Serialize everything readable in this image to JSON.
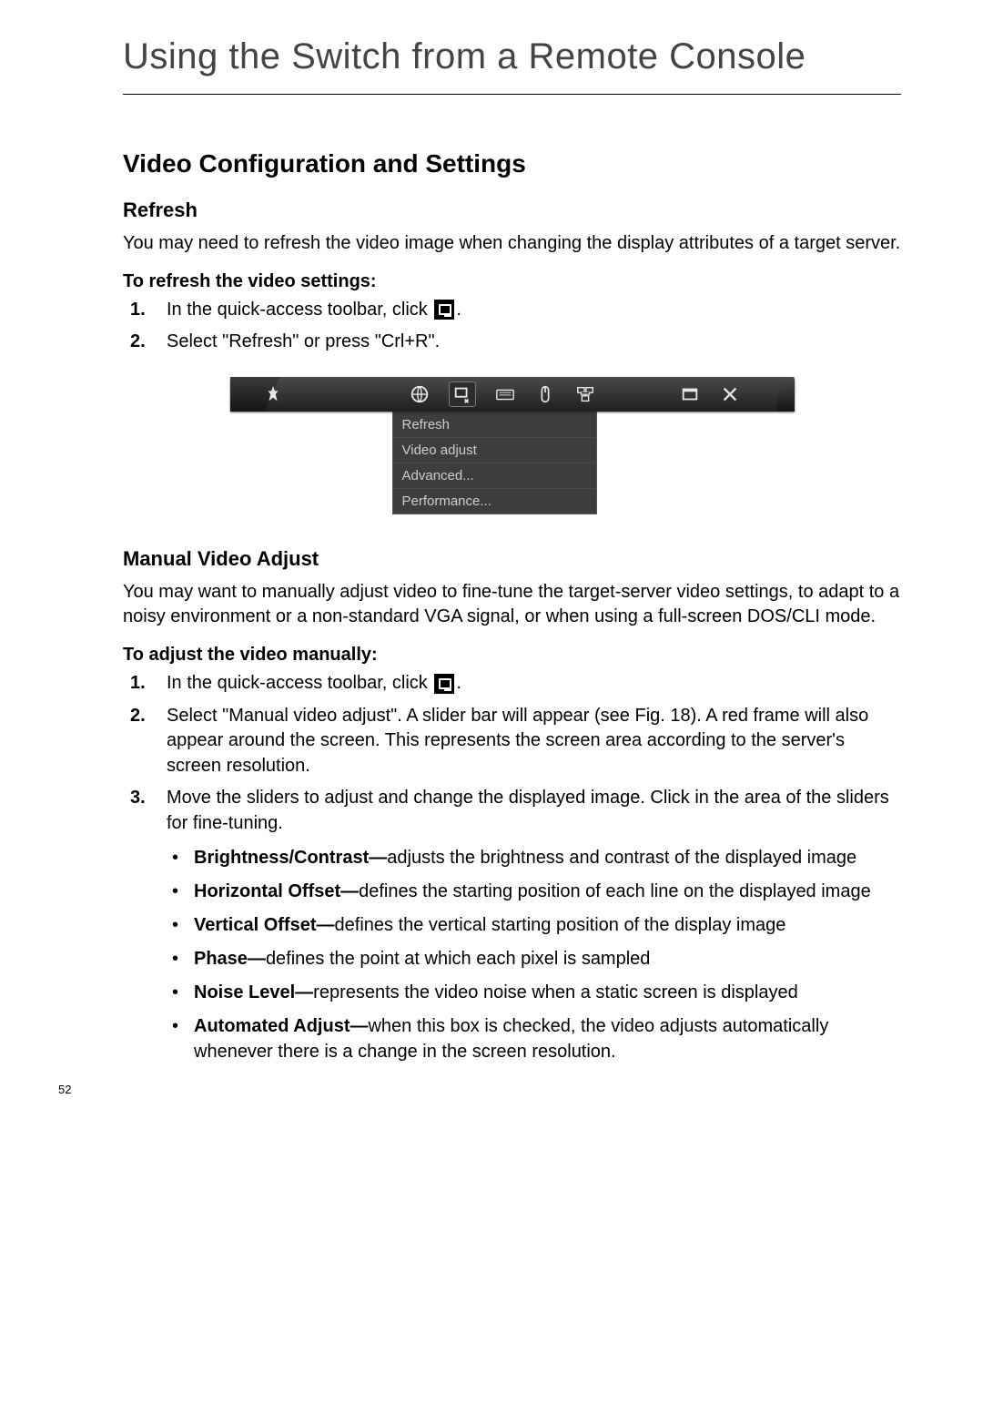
{
  "chapter_title": "Using the Switch from a Remote Console",
  "section_title": "Video Configuration and Settings",
  "refresh": {
    "heading": "Refresh",
    "para": "You may need to refresh the video image when changing the display attributes of a target server.",
    "proc_head": "To refresh the video settings:",
    "step1_prefix": "In the quick-access toolbar, click ",
    "step1_suffix": ".",
    "step2": "Select \"Refresh\" or press \"Crl+R\"."
  },
  "toolbar_menu": {
    "items": [
      "Refresh",
      "Video adjust",
      "Advanced...",
      "Performance..."
    ]
  },
  "manual": {
    "heading": "Manual Video Adjust",
    "para": "You may want to manually adjust video to fine-tune the target-server video settings, to adapt to a noisy environment or a non-standard VGA signal, or when using a full-screen DOS/CLI mode.",
    "proc_head": "To adjust the video manually:",
    "step1_prefix": "In the quick-access toolbar, click ",
    "step1_suffix": ".",
    "step2": "Select \"Manual video adjust\". A slider bar will appear (see Fig. 18). A red frame will also appear around the screen. This represents the screen area according to the server's screen resolution.",
    "step3": "Move the sliders to adjust and change the displayed image. Click in the area of the sliders for fine-tuning.",
    "bullets": [
      {
        "label": "Brightness/Contrast—",
        "text": "adjusts the brightness and contrast of the displayed image"
      },
      {
        "label": "Horizontal Offset—",
        "text": "defines the starting position of each line on the displayed image"
      },
      {
        "label": "Vertical Offset—",
        "text": "defines the vertical starting position of the display image"
      },
      {
        "label": "Phase—",
        "text": "defines the point at which each pixel is sampled"
      },
      {
        "label": "Noise Level—",
        "text": "represents the video noise when a static screen is displayed"
      },
      {
        "label": "Automated Adjust—",
        "text": "when this box is checked, the video adjusts automatically whenever there is a change in the screen resolution."
      }
    ]
  },
  "page_number": "52"
}
